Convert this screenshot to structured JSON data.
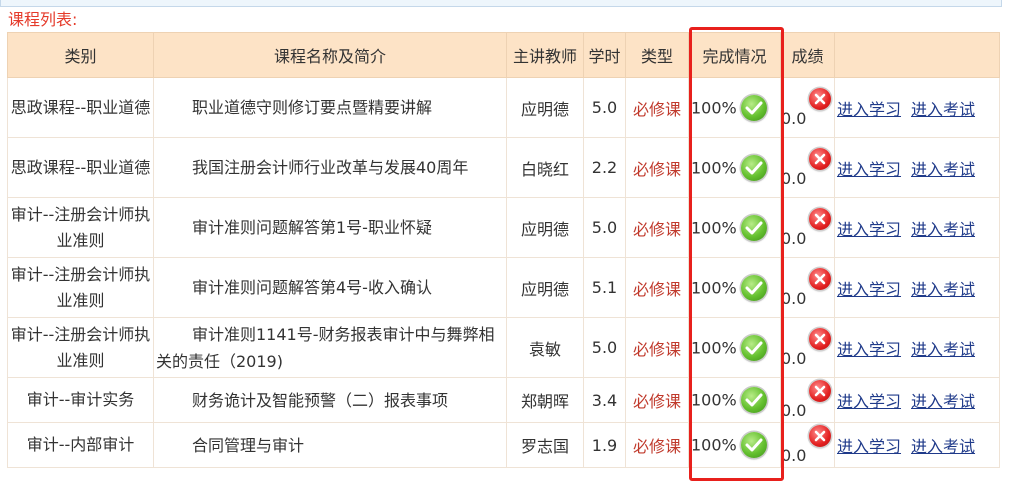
{
  "list_title": "课程列表:",
  "columns": [
    "类别",
    "课程名称及简介",
    "主讲教师",
    "学时",
    "类型",
    "完成情况",
    "成绩",
    ""
  ],
  "rows": [
    {
      "category": "思政课程--职业道德",
      "name": "职业道德守则修订要点暨精要讲解",
      "teacher": "应明德",
      "hours": "5.0",
      "type": "必修课",
      "progress": "100%",
      "score": "0.0",
      "study": "进入学习",
      "exam": "进入考试"
    },
    {
      "category": "思政课程--职业道德",
      "name": "我国注册会计师行业改革与发展40周年",
      "teacher": "白晓红",
      "hours": "2.2",
      "type": "必修课",
      "progress": "100%",
      "score": "0.0",
      "study": "进入学习",
      "exam": "进入考试"
    },
    {
      "category": "审计--注册会计师执业准则",
      "name": "审计准则问题解答第1号-职业怀疑",
      "teacher": "应明德",
      "hours": "5.0",
      "type": "必修课",
      "progress": "100%",
      "score": "0.0",
      "study": "进入学习",
      "exam": "进入考试"
    },
    {
      "category": "审计--注册会计师执业准则",
      "name": "审计准则问题解答第4号-收入确认",
      "teacher": "应明德",
      "hours": "5.1",
      "type": "必修课",
      "progress": "100%",
      "score": "0.0",
      "study": "进入学习",
      "exam": "进入考试"
    },
    {
      "category": "审计--注册会计师执业准则",
      "name": "审计准则1141号-财务报表审计中与舞弊相关的责任（2019)",
      "teacher": "袁敏",
      "hours": "5.0",
      "type": "必修课",
      "progress": "100%",
      "score": "0.0",
      "study": "进入学习",
      "exam": "进入考试"
    },
    {
      "category": "审计--审计实务",
      "name": "财务诡计及智能预警（二）报表事项",
      "teacher": "郑朝晖",
      "hours": "3.4",
      "type": "必修课",
      "progress": "100%",
      "score": "0.0",
      "study": "进入学习",
      "exam": "进入考试"
    },
    {
      "category": "审计--内部审计",
      "name": "合同管理与审计",
      "teacher": "罗志国",
      "hours": "1.9",
      "type": "必修课",
      "progress": "100%",
      "score": "0.0",
      "study": "进入学习",
      "exam": "进入考试"
    }
  ],
  "icons": {
    "complete": "check-circle-icon",
    "score_status": "x-circle-icon"
  },
  "colors": {
    "header_bg": "#fde3c6",
    "required_type": "#c0392b",
    "link": "#1f3a8a",
    "highlight": "#e8201c",
    "title": "#e53a2a"
  }
}
